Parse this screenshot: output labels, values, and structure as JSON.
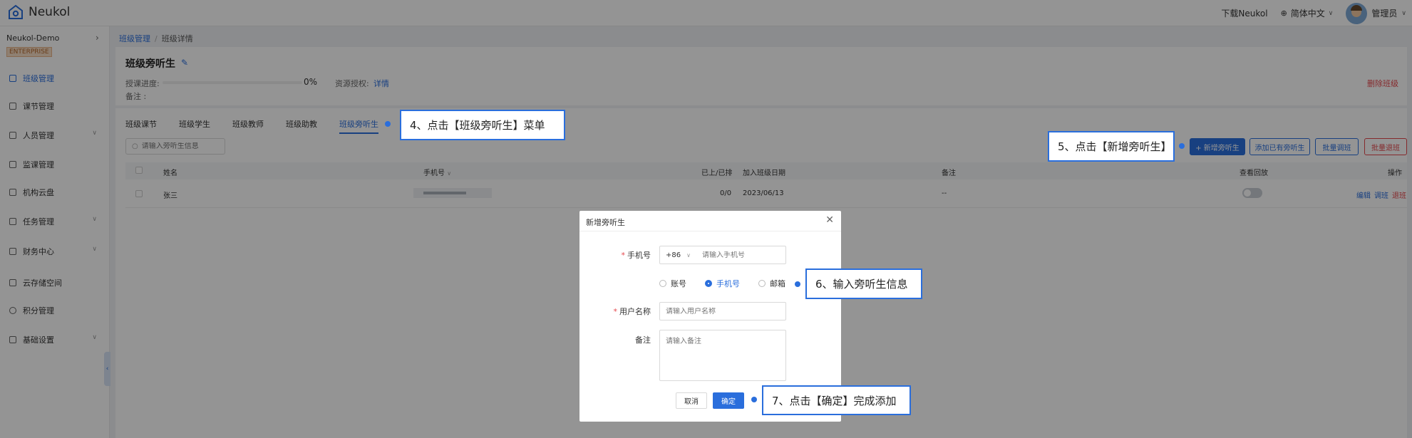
{
  "topbar": {
    "logo_text": "Neukol",
    "download": "下载Neukol",
    "language": "简体中文",
    "user": "管理员"
  },
  "sidebar": {
    "org": "Neukol-Demo",
    "badge": "ENTERPRISE",
    "items": [
      {
        "label": "班级管理",
        "active": true
      },
      {
        "label": "课节管理"
      },
      {
        "label": "人员管理",
        "caret": true
      },
      {
        "label": "监课管理"
      },
      {
        "label": "机构云盘"
      },
      {
        "label": "任务管理",
        "caret": true
      },
      {
        "label": "财务中心",
        "caret": true
      },
      {
        "label": "云存储空间"
      },
      {
        "label": "积分管理"
      },
      {
        "label": "基础设置",
        "caret": true
      }
    ]
  },
  "breadcrumb": {
    "root": "班级管理",
    "separator": "/",
    "current": "班级详情"
  },
  "header": {
    "title": "班级旁听生",
    "progress_label": "授课进度:",
    "progress_value": "0%",
    "progress_fraction": 0,
    "auth_label": "资源授权:",
    "auth_link": "详情",
    "note_label": "备注 :",
    "delete": "删除班级"
  },
  "tabs": [
    "班级课节",
    "班级学生",
    "班级教师",
    "班级助教",
    "班级旁听生"
  ],
  "search": {
    "placeholder": "请输入旁听生信息"
  },
  "buttons": {
    "add": "+ 新增旁听生",
    "add_existing": "添加已有旁听生",
    "batch_transfer": "批量调班",
    "batch_leave": "批量退班"
  },
  "table": {
    "columns": [
      "姓名",
      "手机号",
      "已上/已排",
      "加入班级日期",
      "备注",
      "查看回放",
      "操作"
    ],
    "rows": [
      {
        "name": "张三",
        "progress": "0/0",
        "join_date": "2023/06/13",
        "note": "--",
        "ops": [
          "编辑",
          "调班",
          "退班"
        ]
      }
    ]
  },
  "modal": {
    "title": "新增旁听生",
    "phone_label": "手机号",
    "country_code": "+86",
    "phone_placeholder": "请输入手机号",
    "radio": [
      "账号",
      "手机号",
      "邮箱"
    ],
    "username_label": "用户名称",
    "username_placeholder": "请输入用户名称",
    "note_label": "备注",
    "note_placeholder": "请输入备注",
    "cancel": "取消",
    "confirm": "确定"
  },
  "callouts": {
    "step4": "4、点击【班级旁听生】菜单",
    "step5": "5、点击【新增旁听生】",
    "step6": "6、输入旁听生信息",
    "step7": "7、点击【确定】完成添加"
  },
  "colors": {
    "primary": "#2a6edc",
    "danger": "#e5484d"
  }
}
